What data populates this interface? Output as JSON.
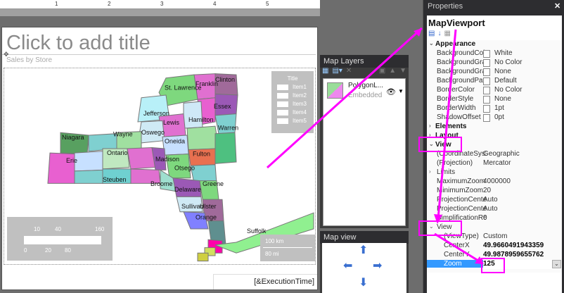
{
  "ruler": {
    "ticks": [
      "1",
      "2",
      "3",
      "4",
      "5"
    ]
  },
  "report": {
    "title_placeholder": "Click to add title",
    "subtitle": "Sales by Store",
    "execution_time": "[&ExecutionTime]",
    "legend": {
      "title": "Title",
      "items": [
        "Item1",
        "Item2",
        "Item3",
        "Item4",
        "Item5"
      ]
    },
    "color_scale": {
      "top_labels": [
        "10",
        "40",
        "160"
      ],
      "bottom_labels": [
        "0",
        "20",
        "80"
      ]
    },
    "distance_scale": {
      "km": "100 km",
      "mi": "80 mi"
    },
    "counties": [
      "St. Lawrence",
      "Franklin",
      "Clinton",
      "Essex",
      "Jefferson",
      "Lewis",
      "Hamilton",
      "Warren",
      "Oswego",
      "Niagara",
      "Wayne",
      "Oneida",
      "Fulton",
      "Ontario",
      "Madison",
      "Erie",
      "Otsego",
      "Steuben",
      "Broome",
      "Delaware",
      "Greene",
      "Ulster",
      "Sullivan",
      "Orange",
      "Suffolk"
    ]
  },
  "map_layers": {
    "title": "Map Layers",
    "layer_name": "PolygonL...",
    "layer_type": "Embedded"
  },
  "map_view": {
    "title": "Map view"
  },
  "properties": {
    "title": "Properties",
    "close": "✕",
    "object": "MapViewport",
    "rows": [
      {
        "type": "cat",
        "label": "Appearance",
        "open": true
      },
      {
        "label": "BackgroundColor",
        "value": "White",
        "swatch": true
      },
      {
        "label": "BackgroundGradi",
        "value": "No Color",
        "swatch": true
      },
      {
        "label": "BackgroundGradi",
        "value": "None",
        "swatch": true
      },
      {
        "label": "BackgroundPatte",
        "value": "Default",
        "swatch": true
      },
      {
        "label": "BorderColor",
        "value": "No Color",
        "swatch": true
      },
      {
        "label": "BorderStyle",
        "value": "None",
        "swatch": true
      },
      {
        "label": "BorderWidth",
        "value": "1pt",
        "swatch": true
      },
      {
        "label": "ShadowOffset",
        "value": "0pt",
        "swatch": true
      },
      {
        "type": "cat",
        "label": "Elements",
        "open": false
      },
      {
        "type": "cat",
        "label": "Layout",
        "open": false
      },
      {
        "type": "cat",
        "label": "View",
        "open": true
      },
      {
        "label": "(CoordinateSyster",
        "value": "Geographic"
      },
      {
        "label": "(Projection)",
        "value": "Mercator"
      },
      {
        "label": "Limits",
        "value": "",
        "expand": true
      },
      {
        "label": "MaximumZoom",
        "value": "4000000"
      },
      {
        "label": "MinimumZoom",
        "value": "20"
      },
      {
        "label": "ProjectionCenter)",
        "value": "Auto"
      },
      {
        "label": "ProjectionCenter\\",
        "value": "Auto"
      },
      {
        "label": "SimplificationReso",
        "value": "0"
      },
      {
        "type": "sub",
        "label": "View",
        "open": true
      },
      {
        "label": "(ViewType)",
        "value": "Custom",
        "indent": true
      },
      {
        "label": "CenterX",
        "value": "49.9660491943359",
        "indent": true,
        "bold": true
      },
      {
        "label": "CenterY",
        "value": "49.9878959655762",
        "indent": true,
        "bold": true
      },
      {
        "label": "Zoom",
        "value": "125",
        "indent": true,
        "bold": true,
        "selected": true
      }
    ]
  },
  "colors": {
    "annotation": "#ff00ff",
    "selection": "#3399ff"
  }
}
